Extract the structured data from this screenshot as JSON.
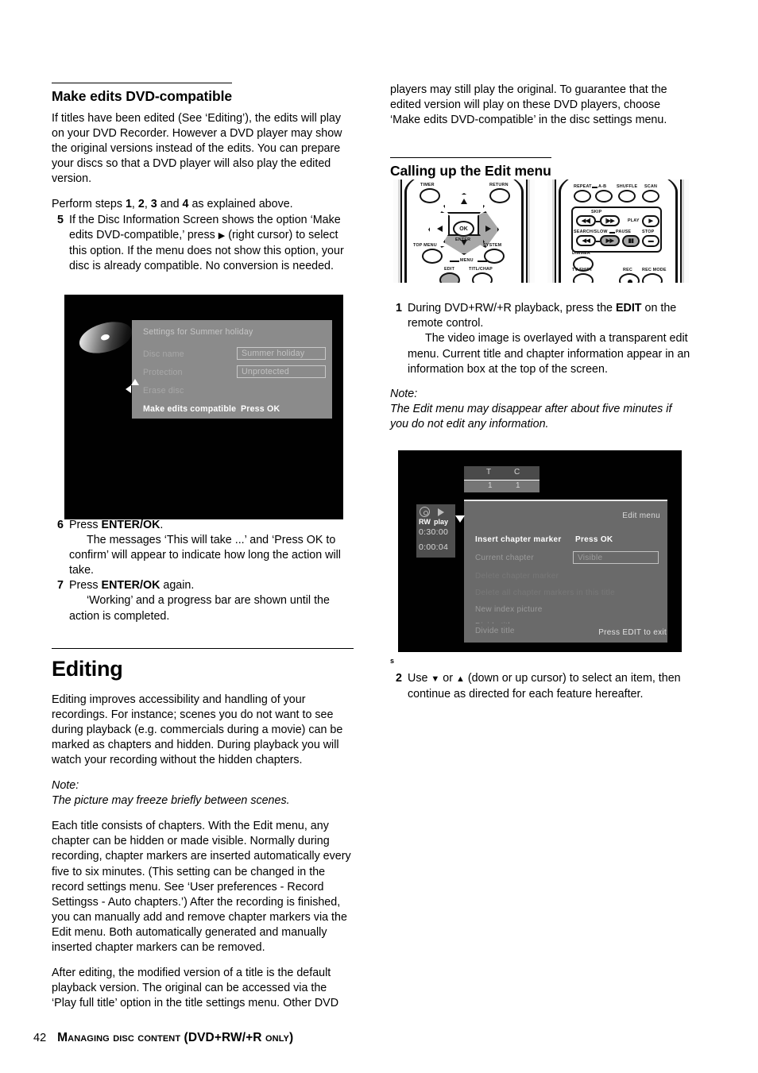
{
  "page": {
    "number": "42",
    "footer_title": "Managing disc content (DVD+RW/+R only)"
  },
  "left_column": {
    "section_heading": "Make edits DVD-compatible",
    "para_1": "If titles have been edited (See ‘Editing’), the edits will play on your DVD Recorder. However a DVD player may show the original versions instead of the edits. You can prepare your discs so that a DVD player will also play the edited version.",
    "para_2_prefix": "Perform steps ",
    "para_2_bold_1": "1",
    "para_2_mid_1": ", ",
    "para_2_bold_2": "2",
    "para_2_mid_2": ", ",
    "para_2_bold_3": "3",
    "para_2_mid_3": " and ",
    "para_2_bold_4": "4",
    "para_2_suffix": " as explained above.",
    "step_5_num": "5",
    "step_5_text_a": "If the Disc Information Screen shows the option ‘Make edits DVD-compatible,’ press ",
    "step_5_cursor_glyph": "▶",
    "step_5_text_b": " (right cursor) to select this option. If the menu does not show this option, your disc is already compatible. No conversion is needed.",
    "step_6_num": "6",
    "step_6_lead": "Press ",
    "step_6_bold": "ENTER/OK",
    "step_6_after": ".",
    "step_6_body": "The messages ‘This will take ...’ and ‘Press OK to confirm’ will appear to indicate how long the action will take.",
    "step_7_num": "7",
    "step_7_lead": "Press ",
    "step_7_bold": "ENTER/OK",
    "step_7_after": " again.",
    "step_7_body": "‘Working’ and a progress bar are shown until the action is completed.",
    "editing_heading": "Editing",
    "editing_para_1": "Editing improves accessibility and handling of your recordings. For instance; scenes you do not want to see during playback (e.g. commercials during a movie) can be marked as chapters and hidden. During playback you will watch your recording without the hidden chapters.",
    "note_label": "Note:",
    "note_text": "The picture may freeze briefly between scenes.",
    "editing_para_2": "Each title consists of chapters. With the Edit menu, any chapter can be hidden or made visible. Normally during recording, chapter markers are inserted automatically every five to six minutes. (This setting can be changed in the record settings menu. See ‘User preferences - Record Settingss - Auto chapters.’) After the recording is finished, you can manually add and remove chapter markers via the Edit menu. Both automatically generated and manually inserted chapter markers can be removed.",
    "editing_para_3": "After editing, the modified version of a title is the default playback version. The original can be accessed via the ‘Play full title’ option in the title settings menu. Other DVD"
  },
  "right_column": {
    "para_continued": "players may still play the original. To guarantee that the edited version will play on these DVD players, choose ‘Make edits DVD-compatible’ in the disc settings menu.",
    "section_heading": "Calling up the Edit menu",
    "step_1_num": "1",
    "step_1_lead": "During DVD+RW/+R playback, press the ",
    "step_1_bold": "EDIT",
    "step_1_after": " on the remote control.",
    "step_1_body": "The video image is overlayed with a transparent edit menu. Current title and chapter information appear in an information box at the top of the screen.",
    "note_label": "Note:",
    "note_text": "The Edit menu may disappear after about five minutes if you do not edit any information.",
    "stray_char": "s",
    "step_2_num": "2",
    "step_2_text_a": "Use ",
    "step_2_glyph_down": "▼",
    "step_2_text_b": " or ",
    "step_2_glyph_up": "▲",
    "step_2_text_c": " (down or up cursor) to select an item, then continue as directed for each feature hereafter."
  },
  "disc_settings_screen": {
    "title": "Settings for Summer holiday",
    "rows": [
      {
        "label": "Disc name",
        "value": "Summer holiday",
        "value_style": "box",
        "state": "dim"
      },
      {
        "label": "Protection",
        "value": "Unprotected",
        "value_style": "box",
        "state": "dim"
      },
      {
        "label": "Erase disc",
        "value": "",
        "value_style": "none",
        "state": "dim"
      },
      {
        "label": "Make edits compatible",
        "value": "Press OK",
        "value_style": "plain",
        "state": "selected"
      }
    ]
  },
  "remote_1": {
    "buttons": [
      "TIMER",
      "RETURN",
      "TOP MENU",
      "SYSTEM",
      "EDIT",
      "TITL/CHAP"
    ],
    "menu_label": "MENU",
    "ok_label": "OK",
    "enter_label": "ENTER",
    "highlighted": [
      "right-cursor",
      "down-cursor",
      "EDIT"
    ]
  },
  "remote_2": {
    "buttons": [
      "REPEAT",
      "A-B",
      "SHUFFLE",
      "SCAN",
      "PLAY",
      "STOP",
      "DIMMER",
      "TV SHIFT",
      "REC",
      "REC MODE"
    ],
    "skip_label": "SKIP",
    "search_label": "SEARCH/SLOW",
    "pause_label": "PAUSE",
    "highlighted": [
      "search-slow-forward",
      "PAUSE"
    ]
  },
  "edit_menu_screen": {
    "info_box": {
      "headers": [
        "T",
        "C"
      ],
      "values": [
        "1",
        "1"
      ]
    },
    "status_panel": {
      "disc_type": "RW",
      "mode": "play",
      "total_time": "0:30:00",
      "elapsed_time": "0:00:04"
    },
    "title": "Edit menu",
    "footer": "Press EDIT to exit",
    "items": [
      {
        "label": "Insert chapter marker",
        "value": "Press OK",
        "value_style": "plain",
        "state": "selected"
      },
      {
        "label": "Current chapter",
        "value": "Visible",
        "value_style": "box",
        "state": "normal"
      },
      {
        "label": "Delete chapter marker",
        "value": "",
        "value_style": "none",
        "state": "disabled"
      },
      {
        "label": "Delete all chapter markers in this title",
        "value": "",
        "value_style": "none",
        "state": "disabled"
      },
      {
        "label": "New index picture",
        "value": "",
        "value_style": "none",
        "state": "normal"
      },
      {
        "label": "Divide title",
        "value": "",
        "value_style": "none",
        "state": "normal"
      }
    ]
  },
  "colors": {
    "screen_bg": "#010101",
    "panel_gray": "#8b8b8b",
    "edit_panel_gray": "#6a6a6a",
    "status_panel_gray": "#4e4e4e",
    "selected_text": "#ffffff",
    "dim_text": "#a8a8a8"
  }
}
